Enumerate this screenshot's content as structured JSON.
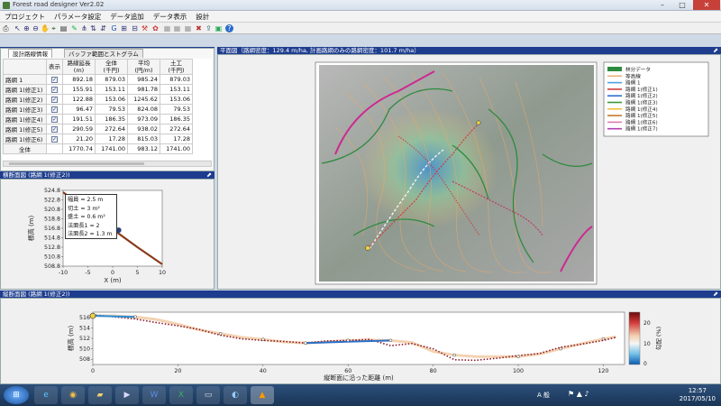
{
  "window": {
    "title": "Forest road designer Ver2.02"
  },
  "menu": [
    "プロジェクト",
    "パラメータ設定",
    "データ追加",
    "データ表示",
    "設計"
  ],
  "left_panel": {
    "tabs": [
      "設計路線情報",
      "バッファ範囲とストグラム"
    ],
    "columns": [
      "表示",
      "路線延長\n(m)",
      "全体\n(千円)",
      "平均\n(円/m)",
      "土工\n(千円)"
    ],
    "rows": [
      {
        "name": "路網 1",
        "show": true,
        "length": "892.18",
        "total": "879.03",
        "avg": "985.24",
        "earth": "879.03"
      },
      {
        "name": "路網 1(修正1)",
        "show": true,
        "length": "155.91",
        "total": "153.11",
        "avg": "981.78",
        "earth": "153.11"
      },
      {
        "name": "路網 1(修正2)",
        "show": true,
        "length": "122.88",
        "total": "153.06",
        "avg": "1245.62",
        "earth": "153.06"
      },
      {
        "name": "路網 1(修正3)",
        "show": true,
        "length": "96.47",
        "total": "79.53",
        "avg": "824.08",
        "earth": "79.53"
      },
      {
        "name": "路網 1(修正4)",
        "show": true,
        "length": "191.51",
        "total": "186.35",
        "avg": "973.09",
        "earth": "186.35"
      },
      {
        "name": "路網 1(修正5)",
        "show": true,
        "length": "290.59",
        "total": "272.64",
        "avg": "938.02",
        "earth": "272.64"
      },
      {
        "name": "路網 1(修正6)",
        "show": true,
        "length": "21.20",
        "total": "17.28",
        "avg": "815.03",
        "earth": "17.28"
      },
      {
        "name": "全体",
        "show": false,
        "length": "1770.74",
        "total": "1741.00",
        "avg": "983.12",
        "earth": "1741.00"
      }
    ]
  },
  "cross_panel": {
    "header": "横断面図 (路網 1(修正2))",
    "info": [
      "幅員 = 2.5 m",
      "切土 = 3 m²",
      "盛土 = 0.6 m²",
      "法面長1 = 2",
      "法面長2 = 1.3 m"
    ],
    "ylabel": "標高 (m)",
    "xlabel": "X (m)",
    "yticks": [
      "524.8",
      "522.8",
      "520.8",
      "518.8",
      "516.8",
      "514.8",
      "512.8",
      "510.8",
      "508.8"
    ],
    "xticks": [
      "-10",
      "-5",
      "0",
      "5",
      "10"
    ]
  },
  "plan_panel": {
    "header": "平面図（路網密度：129.4 m/ha, 計画路網のみの路網密度：101.7 m/ha）",
    "legend": [
      "林分データ",
      "等高線",
      "路網 1",
      "路網 1(修正1)",
      "路網 1(修正2)",
      "路網 1(修正3)",
      "路網 1(修正4)",
      "路網 1(修正5)",
      "路網 1(修正6)",
      "路網 1(修正7)"
    ],
    "legend_colors": [
      "#2e8b3e",
      "#e8b27a",
      "#4aa3df",
      "#d23a3a",
      "#2f6fd1",
      "#3a9a3a",
      "#f0c040",
      "#c77a2a",
      "#e07ab0",
      "#b040b0"
    ]
  },
  "long_panel": {
    "header": "縦断面図 (路網 1(修正2))",
    "ylabel": "標高 (m)",
    "xlabel": "縦断面に沿った距離 (m)",
    "yticks": [
      "516",
      "514",
      "512",
      "510",
      "508"
    ],
    "xticks": [
      "0",
      "20",
      "40",
      "60",
      "80",
      "100",
      "120"
    ],
    "colorbar_label": "勾配 (%)",
    "colorbar_ticks": [
      "20",
      "10",
      "0"
    ]
  },
  "chart_data": [
    {
      "type": "line",
      "title": "",
      "xlabel": "X (m)",
      "ylabel": "標高 (m)",
      "xlim": [
        -10,
        10
      ],
      "ylim": [
        508.8,
        524.8
      ],
      "series": [
        {
          "x": [
            -10,
            -5,
            0,
            5,
            10
          ],
          "y": [
            524.4,
            520.6,
            516.6,
            512.8,
            509.2
          ]
        }
      ]
    },
    {
      "type": "line",
      "title": "",
      "xlabel": "縦断面に沿った距離 (m)",
      "ylabel": "標高 (m)",
      "xlim": [
        0,
        125
      ],
      "ylim": [
        507,
        517
      ],
      "series": [
        {
          "x": [
            0,
            5,
            10,
            15,
            20,
            25,
            30,
            35,
            40,
            45,
            50,
            55,
            60,
            65,
            70,
            75,
            80,
            85,
            90,
            95,
            100,
            105,
            110,
            115,
            120,
            123
          ],
          "y": [
            516.3,
            516.3,
            516.1,
            515.6,
            514.7,
            513.6,
            512.9,
            512.2,
            511.8,
            511.3,
            511.1,
            511.3,
            511.6,
            511.7,
            511.6,
            511.2,
            509.5,
            508.8,
            508.5,
            508.5,
            508.5,
            509.0,
            510.0,
            511.0,
            511.9,
            512.3
          ]
        },
        {
          "x": [
            0,
            5,
            10,
            15,
            20,
            25,
            30,
            35,
            40,
            45,
            50,
            55,
            60,
            65,
            70,
            75,
            80,
            85,
            90,
            95,
            100,
            105,
            110,
            115,
            120,
            123
          ],
          "y": [
            516.5,
            516.1,
            515.7,
            515.0,
            514.4,
            513.7,
            512.6,
            511.9,
            511.6,
            511.4,
            511.1,
            511.5,
            511.6,
            511.8,
            510.6,
            511.0,
            510.0,
            507.9,
            507.8,
            508.2,
            508.7,
            509.1,
            510.3,
            510.9,
            511.6,
            512.2
          ]
        }
      ]
    }
  ],
  "taskbar": {
    "time": "12:57",
    "date": "2017/05/10",
    "ime": "A 般"
  }
}
